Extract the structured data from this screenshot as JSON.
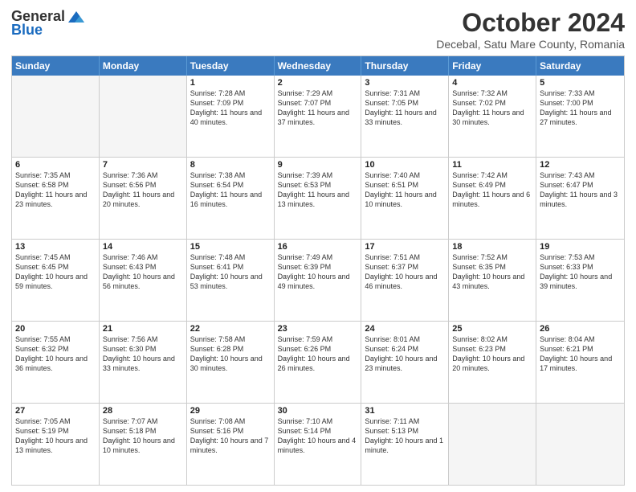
{
  "header": {
    "logo_general": "General",
    "logo_blue": "Blue",
    "month_title": "October 2024",
    "subtitle": "Decebal, Satu Mare County, Romania"
  },
  "day_names": [
    "Sunday",
    "Monday",
    "Tuesday",
    "Wednesday",
    "Thursday",
    "Friday",
    "Saturday"
  ],
  "weeks": [
    [
      {
        "day": "",
        "empty": true
      },
      {
        "day": "",
        "empty": true
      },
      {
        "day": "1",
        "sunrise": "Sunrise: 7:28 AM",
        "sunset": "Sunset: 7:09 PM",
        "daylight": "Daylight: 11 hours and 40 minutes."
      },
      {
        "day": "2",
        "sunrise": "Sunrise: 7:29 AM",
        "sunset": "Sunset: 7:07 PM",
        "daylight": "Daylight: 11 hours and 37 minutes."
      },
      {
        "day": "3",
        "sunrise": "Sunrise: 7:31 AM",
        "sunset": "Sunset: 7:05 PM",
        "daylight": "Daylight: 11 hours and 33 minutes."
      },
      {
        "day": "4",
        "sunrise": "Sunrise: 7:32 AM",
        "sunset": "Sunset: 7:02 PM",
        "daylight": "Daylight: 11 hours and 30 minutes."
      },
      {
        "day": "5",
        "sunrise": "Sunrise: 7:33 AM",
        "sunset": "Sunset: 7:00 PM",
        "daylight": "Daylight: 11 hours and 27 minutes."
      }
    ],
    [
      {
        "day": "6",
        "sunrise": "Sunrise: 7:35 AM",
        "sunset": "Sunset: 6:58 PM",
        "daylight": "Daylight: 11 hours and 23 minutes."
      },
      {
        "day": "7",
        "sunrise": "Sunrise: 7:36 AM",
        "sunset": "Sunset: 6:56 PM",
        "daylight": "Daylight: 11 hours and 20 minutes."
      },
      {
        "day": "8",
        "sunrise": "Sunrise: 7:38 AM",
        "sunset": "Sunset: 6:54 PM",
        "daylight": "Daylight: 11 hours and 16 minutes."
      },
      {
        "day": "9",
        "sunrise": "Sunrise: 7:39 AM",
        "sunset": "Sunset: 6:53 PM",
        "daylight": "Daylight: 11 hours and 13 minutes."
      },
      {
        "day": "10",
        "sunrise": "Sunrise: 7:40 AM",
        "sunset": "Sunset: 6:51 PM",
        "daylight": "Daylight: 11 hours and 10 minutes."
      },
      {
        "day": "11",
        "sunrise": "Sunrise: 7:42 AM",
        "sunset": "Sunset: 6:49 PM",
        "daylight": "Daylight: 11 hours and 6 minutes."
      },
      {
        "day": "12",
        "sunrise": "Sunrise: 7:43 AM",
        "sunset": "Sunset: 6:47 PM",
        "daylight": "Daylight: 11 hours and 3 minutes."
      }
    ],
    [
      {
        "day": "13",
        "sunrise": "Sunrise: 7:45 AM",
        "sunset": "Sunset: 6:45 PM",
        "daylight": "Daylight: 10 hours and 59 minutes."
      },
      {
        "day": "14",
        "sunrise": "Sunrise: 7:46 AM",
        "sunset": "Sunset: 6:43 PM",
        "daylight": "Daylight: 10 hours and 56 minutes."
      },
      {
        "day": "15",
        "sunrise": "Sunrise: 7:48 AM",
        "sunset": "Sunset: 6:41 PM",
        "daylight": "Daylight: 10 hours and 53 minutes."
      },
      {
        "day": "16",
        "sunrise": "Sunrise: 7:49 AM",
        "sunset": "Sunset: 6:39 PM",
        "daylight": "Daylight: 10 hours and 49 minutes."
      },
      {
        "day": "17",
        "sunrise": "Sunrise: 7:51 AM",
        "sunset": "Sunset: 6:37 PM",
        "daylight": "Daylight: 10 hours and 46 minutes."
      },
      {
        "day": "18",
        "sunrise": "Sunrise: 7:52 AM",
        "sunset": "Sunset: 6:35 PM",
        "daylight": "Daylight: 10 hours and 43 minutes."
      },
      {
        "day": "19",
        "sunrise": "Sunrise: 7:53 AM",
        "sunset": "Sunset: 6:33 PM",
        "daylight": "Daylight: 10 hours and 39 minutes."
      }
    ],
    [
      {
        "day": "20",
        "sunrise": "Sunrise: 7:55 AM",
        "sunset": "Sunset: 6:32 PM",
        "daylight": "Daylight: 10 hours and 36 minutes."
      },
      {
        "day": "21",
        "sunrise": "Sunrise: 7:56 AM",
        "sunset": "Sunset: 6:30 PM",
        "daylight": "Daylight: 10 hours and 33 minutes."
      },
      {
        "day": "22",
        "sunrise": "Sunrise: 7:58 AM",
        "sunset": "Sunset: 6:28 PM",
        "daylight": "Daylight: 10 hours and 30 minutes."
      },
      {
        "day": "23",
        "sunrise": "Sunrise: 7:59 AM",
        "sunset": "Sunset: 6:26 PM",
        "daylight": "Daylight: 10 hours and 26 minutes."
      },
      {
        "day": "24",
        "sunrise": "Sunrise: 8:01 AM",
        "sunset": "Sunset: 6:24 PM",
        "daylight": "Daylight: 10 hours and 23 minutes."
      },
      {
        "day": "25",
        "sunrise": "Sunrise: 8:02 AM",
        "sunset": "Sunset: 6:23 PM",
        "daylight": "Daylight: 10 hours and 20 minutes."
      },
      {
        "day": "26",
        "sunrise": "Sunrise: 8:04 AM",
        "sunset": "Sunset: 6:21 PM",
        "daylight": "Daylight: 10 hours and 17 minutes."
      }
    ],
    [
      {
        "day": "27",
        "sunrise": "Sunrise: 7:05 AM",
        "sunset": "Sunset: 5:19 PM",
        "daylight": "Daylight: 10 hours and 13 minutes."
      },
      {
        "day": "28",
        "sunrise": "Sunrise: 7:07 AM",
        "sunset": "Sunset: 5:18 PM",
        "daylight": "Daylight: 10 hours and 10 minutes."
      },
      {
        "day": "29",
        "sunrise": "Sunrise: 7:08 AM",
        "sunset": "Sunset: 5:16 PM",
        "daylight": "Daylight: 10 hours and 7 minutes."
      },
      {
        "day": "30",
        "sunrise": "Sunrise: 7:10 AM",
        "sunset": "Sunset: 5:14 PM",
        "daylight": "Daylight: 10 hours and 4 minutes."
      },
      {
        "day": "31",
        "sunrise": "Sunrise: 7:11 AM",
        "sunset": "Sunset: 5:13 PM",
        "daylight": "Daylight: 10 hours and 1 minute."
      },
      {
        "day": "",
        "empty": true
      },
      {
        "day": "",
        "empty": true
      }
    ]
  ]
}
